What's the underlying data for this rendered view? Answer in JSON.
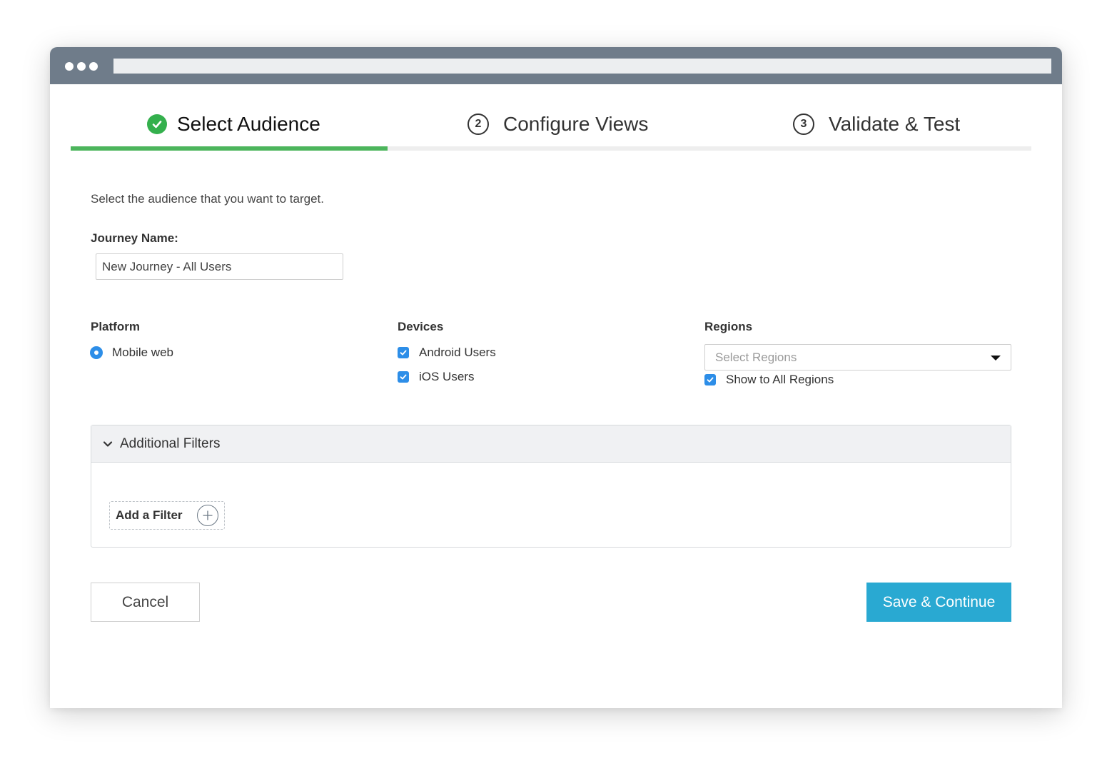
{
  "colors": {
    "titlebar": "#6f7c8a",
    "progress": "#4cb55c",
    "accent": "#2d8ee8",
    "primary_button": "#29a9d2"
  },
  "steps": [
    {
      "number": "",
      "label": "Select Audience",
      "status": "complete",
      "icon": "check-circle-icon"
    },
    {
      "number": "2",
      "label": "Configure Views",
      "status": "pending"
    },
    {
      "number": "3",
      "label": "Validate & Test",
      "status": "pending"
    }
  ],
  "progress_fraction": 0.33,
  "intro_text": "Select the audience that you want to target.",
  "journey": {
    "label": "Journey Name:",
    "value": "New Journey - All Users"
  },
  "platform": {
    "label": "Platform",
    "option": "Mobile web"
  },
  "devices": {
    "label": "Devices",
    "options": [
      "Android Users",
      "iOS Users"
    ]
  },
  "regions": {
    "label": "Regions",
    "placeholder": "Select Regions",
    "show_all_label": "Show to All Regions"
  },
  "filters": {
    "title": "Additional Filters",
    "add_label": "Add a Filter"
  },
  "actions": {
    "cancel": "Cancel",
    "save": "Save & Continue"
  }
}
